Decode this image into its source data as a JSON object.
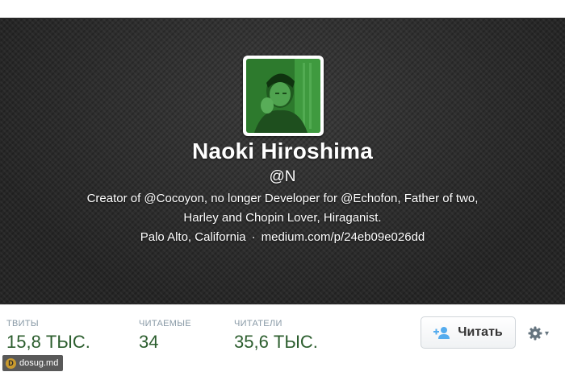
{
  "profile": {
    "name": "Naoki Hiroshima",
    "handle": "@N",
    "bio_line1": "Creator of @Cocoyon, no longer Developer for @Echofon, Father of two,",
    "bio_line2": "Harley and Chopin Lover, Hiraganist.",
    "location": "Palo Alto, California",
    "separator": "·",
    "url": "medium.com/p/24eb09e026dd",
    "avatar_icon": "profile-photo-green-tint"
  },
  "stats": {
    "tweets_label": "ТВИТЫ",
    "tweets_value": "15,8 ТЫС.",
    "following_label": "ЧИТАЕМЫЕ",
    "following_value": "34",
    "followers_label": "ЧИТАТЕЛИ",
    "followers_value": "35,6 ТЫС."
  },
  "actions": {
    "follow_label": "Читать",
    "follow_icon": "add-user-icon",
    "settings_icon": "gear-icon",
    "settings_chevron": "chevron-down-icon"
  },
  "watermark": {
    "text": "dosug.md",
    "logo": "D"
  },
  "colors": {
    "stat_value": "#2c5e2e",
    "stat_label": "#8899a6",
    "follow_icon": "#55acee",
    "avatar_tint": "#2f8f2f"
  }
}
